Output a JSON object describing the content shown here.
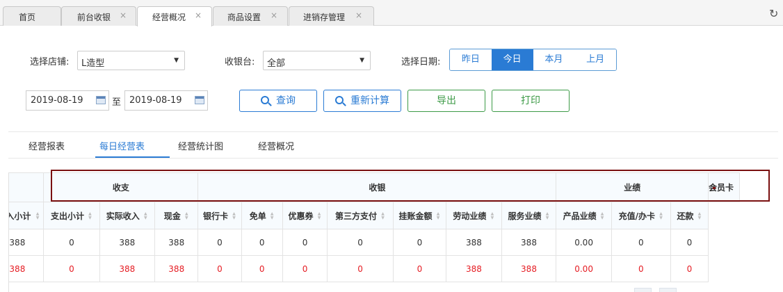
{
  "tabs": [
    {
      "label": "首页",
      "closable": false,
      "active": false
    },
    {
      "label": "前台收银",
      "closable": true,
      "active": false
    },
    {
      "label": "经营概况",
      "closable": true,
      "active": true
    },
    {
      "label": "商品设置",
      "closable": true,
      "active": false
    },
    {
      "label": "进销存管理",
      "closable": true,
      "active": false
    }
  ],
  "tab_close_glyph": "×",
  "reload_glyph": "↻",
  "filters": {
    "store_label": "选择店铺:",
    "store_value": "L造型",
    "register_label": "收银台:",
    "register_value": "全部",
    "date_label": "选择日期:",
    "date_buttons": [
      "昨日",
      "今日",
      "本月",
      "上月"
    ],
    "active_date_button": "今日",
    "start_date": "2019-08-19",
    "to_label": "至",
    "end_date": "2019-08-19"
  },
  "actions": {
    "query": "查询",
    "recalc": "重新计算",
    "export": "导出",
    "print": "打印"
  },
  "subtabs": [
    "经营报表",
    "每日经营表",
    "经营统计图",
    "经营概况"
  ],
  "active_subtab": "每日经营表",
  "table": {
    "groups": [
      {
        "label": "",
        "span": 1
      },
      {
        "label": "收支",
        "span": 3
      },
      {
        "label": "收银",
        "span": 7
      },
      {
        "label": "业绩",
        "span": 3
      },
      {
        "label": "会员卡",
        "span": 2
      }
    ],
    "columns": [
      "入小计",
      "支出小计",
      "实际收入",
      "现金",
      "银行卡",
      "免单",
      "优惠券",
      "第三方支付",
      "挂账金额",
      "劳动业绩",
      "服务业绩",
      "产品业绩",
      "充值/办卡",
      "还款"
    ],
    "rows": [
      {
        "style": "normal",
        "cells": [
          "388",
          "0",
          "388",
          "388",
          "0",
          "0",
          "0",
          "0",
          "0",
          "388",
          "388",
          "0.00",
          "0",
          "0"
        ]
      },
      {
        "style": "red",
        "cells": [
          "388",
          "0",
          "388",
          "388",
          "0",
          "0",
          "0",
          "0",
          "0",
          "388",
          "388",
          "0.00",
          "0",
          "0"
        ]
      }
    ]
  },
  "colors": {
    "accent": "#2a7bd4",
    "green": "#3c9a46",
    "total_red": "#e51c23",
    "highlight": "#7a1010"
  }
}
